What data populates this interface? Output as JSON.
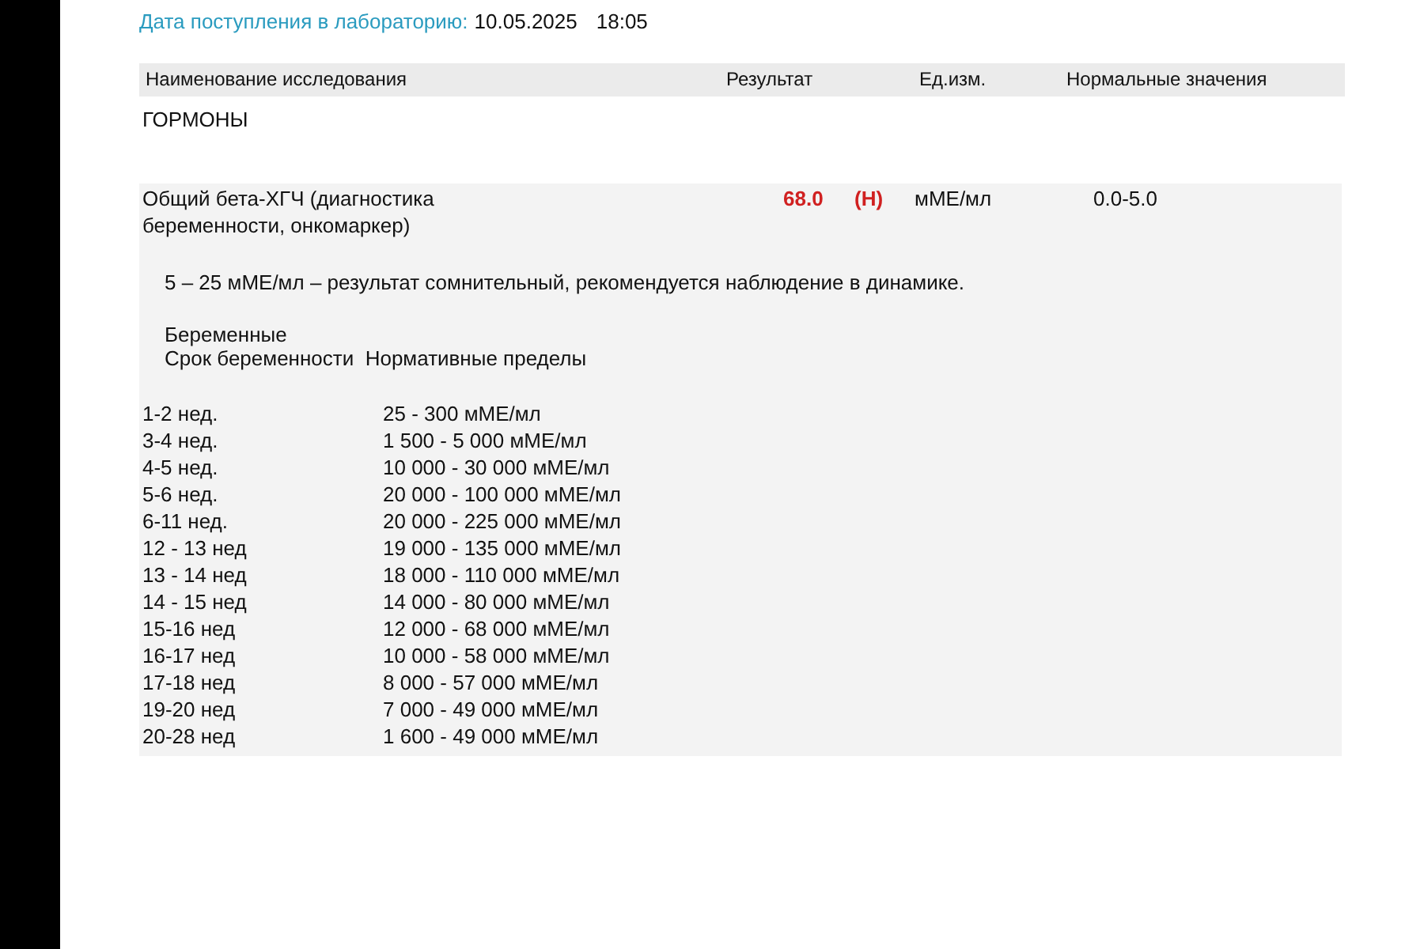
{
  "header": {
    "label": "Дата поступления в лабораторию:",
    "date": "10.05.2025",
    "time": "18:05"
  },
  "table": {
    "columns": [
      "Наименование исследования",
      "Результат",
      "Ед.изм.",
      "Нормальные значения"
    ],
    "section": "ГОРМОНЫ",
    "rows": [
      {
        "name": "Общий бета-ХГЧ (диагностика беременности, онкомаркер)",
        "result": "68.0",
        "flag": "(H)",
        "abnormal": true,
        "unit": "мМЕ/мл",
        "reference": "0.0-5.0",
        "note": "5 – 25 мМЕ/мл – результат сомнительный, рекомендуется наблюдение в динамике.",
        "group_title": "Беременные",
        "ref_header": "Срок беременности  Нормативные пределы",
        "ranges": [
          {
            "term": "1-2 нед.",
            "limits": "25 - 300 мМЕ/мл"
          },
          {
            "term": "3-4 нед.",
            "limits": "1 500 - 5 000 мМЕ/мл"
          },
          {
            "term": "4-5 нед.",
            "limits": "10 000 - 30 000 мМЕ/мл"
          },
          {
            "term": "5-6 нед.",
            "limits": "20 000 - 100 000 мМЕ/мл"
          },
          {
            "term": "6-11 нед.",
            "limits": "20 000 - 225 000 мМЕ/мл"
          },
          {
            "term": "12 - 13 нед",
            "limits": "19 000 - 135 000 мМЕ/мл"
          },
          {
            "term": "13 - 14 нед",
            "limits": "18 000 - 110 000 мМЕ/мл"
          },
          {
            "term": "14 - 15 нед",
            "limits": "14 000 - 80 000 мМЕ/мл"
          },
          {
            "term": "15-16 нед",
            "limits": "12 000 - 68 000 мМЕ/мл"
          },
          {
            "term": "16-17 нед",
            "limits": "10 000 - 58 000 мМЕ/мл"
          },
          {
            "term": "17-18 нед",
            "limits": "8 000 - 57 000 мМЕ/мл"
          },
          {
            "term": "19-20 нед",
            "limits": "7 000 - 49 000 мМЕ/мл"
          },
          {
            "term": "20-28 нед",
            "limits": "1 600 - 49 000 мМЕ/мл"
          }
        ]
      }
    ]
  }
}
